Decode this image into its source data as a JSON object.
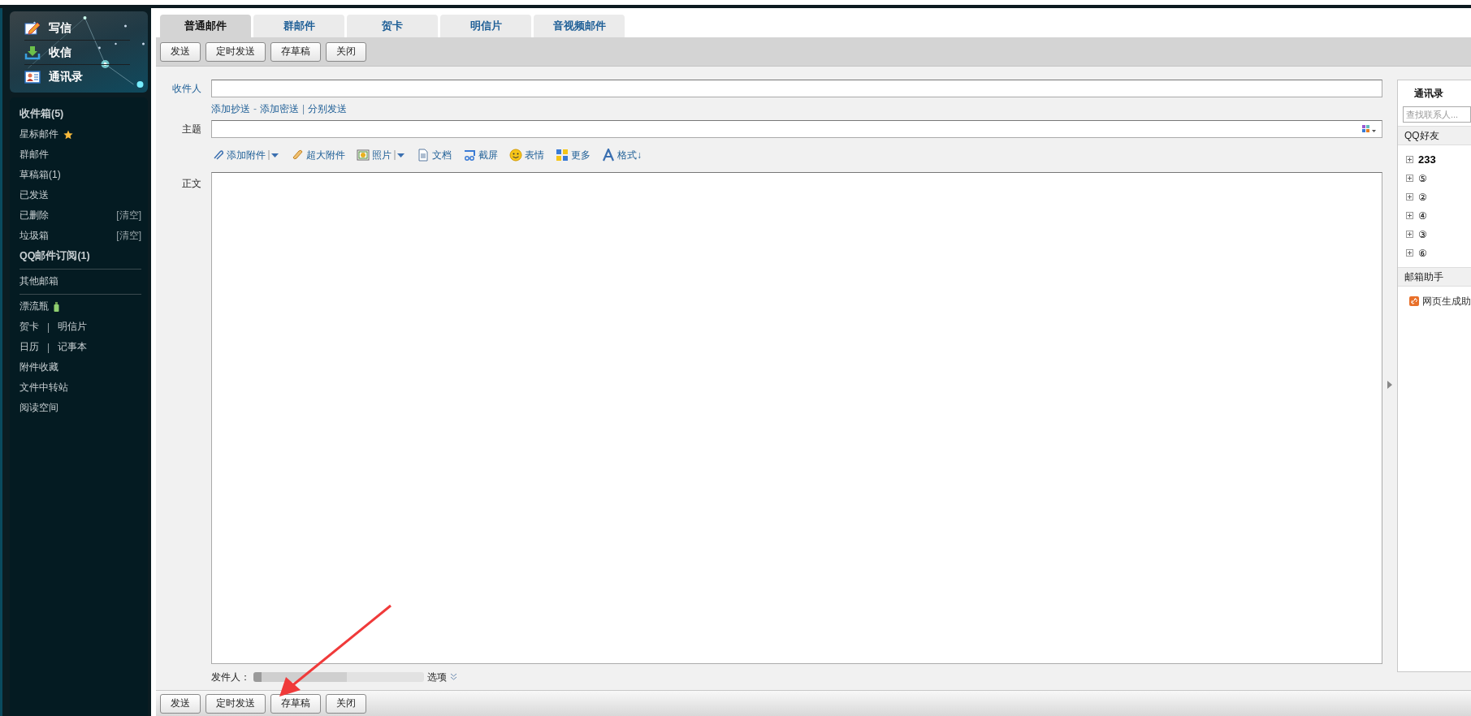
{
  "nav": [
    {
      "label": "写信"
    },
    {
      "label": "收信"
    },
    {
      "label": "通讯录"
    }
  ],
  "folder_groups": [
    [
      {
        "kind": "plain",
        "label": "收件箱(5)",
        "unread": true
      },
      {
        "kind": "star",
        "label": "星标邮件",
        "unread": false
      },
      {
        "kind": "plain",
        "label": "群邮件",
        "unread": false
      },
      {
        "kind": "plain",
        "label": "草稿箱(1)",
        "unread": false
      },
      {
        "kind": "plain",
        "label": "已发送",
        "unread": false
      },
      {
        "kind": "clear",
        "label": "已删除",
        "action": "[清空]",
        "unread": false
      },
      {
        "kind": "clear",
        "label": "垃圾箱",
        "action": "[清空]",
        "unread": false
      },
      {
        "kind": "plain",
        "label": "QQ邮件订阅(1)",
        "unread": true
      }
    ],
    [
      {
        "kind": "plain",
        "label": "其他邮箱",
        "unread": false
      }
    ],
    [
      {
        "kind": "bottle",
        "label": "漂流瓶",
        "unread": false
      },
      {
        "kind": "pair",
        "label": "贺卡",
        "second": "明信片",
        "separator": "|",
        "unread": false
      },
      {
        "kind": "pair",
        "label": "日历",
        "second": "记事本",
        "separator": "|",
        "unread": false
      },
      {
        "kind": "plain",
        "label": "附件收藏",
        "unread": false
      },
      {
        "kind": "plain",
        "label": "文件中转站",
        "unread": false
      },
      {
        "kind": "plain",
        "label": "阅读空间",
        "unread": false
      }
    ]
  ],
  "tabs": [
    {
      "label": "普通邮件",
      "selected": true
    },
    {
      "label": "群邮件",
      "selected": false
    },
    {
      "label": "贺卡",
      "selected": false
    },
    {
      "label": "明信片",
      "selected": false
    },
    {
      "label": "音视频邮件",
      "selected": false
    }
  ],
  "top_buttons": [
    "发送",
    "定时发送",
    "存草稿",
    "关闭"
  ],
  "compose": {
    "to_label": "收件人",
    "recipient_links": [
      {
        "kind": "link",
        "text": "添加抄送"
      },
      {
        "kind": "sep",
        "text": "-"
      },
      {
        "kind": "link",
        "text": "添加密送"
      },
      {
        "kind": "sep",
        "text": "|"
      },
      {
        "kind": "link",
        "text": "分别发送"
      }
    ],
    "subject_label": "主题",
    "attach_tools": [
      {
        "label": "添加附件",
        "dropdown": true
      },
      {
        "label": "超大附件",
        "dropdown": false
      },
      {
        "label": "照片",
        "dropdown": true
      },
      {
        "label": "文档",
        "dropdown": false
      },
      {
        "label": "截屏",
        "dropdown": false
      },
      {
        "label": "表情",
        "dropdown": false
      },
      {
        "label": "更多",
        "dropdown": false
      },
      {
        "label": "格式↓",
        "dropdown": false
      }
    ],
    "body_label": "正文",
    "sender_label": "发件人：",
    "options_label": "选项"
  },
  "bottom_buttons": [
    "发送",
    "定时发送",
    "存草稿",
    "关闭"
  ],
  "contacts": {
    "title": "通讯录",
    "search_placeholder": "查找联系人...",
    "sections": [
      {
        "title": "QQ好友",
        "groups": [
          {
            "label": "233",
            "expanded": false
          },
          {
            "label": "⑤",
            "expanded": false
          },
          {
            "label": "②",
            "expanded": false
          },
          {
            "label": "④",
            "expanded": false
          },
          {
            "label": "③",
            "expanded": false
          },
          {
            "label": "⑥",
            "expanded": false
          }
        ]
      },
      {
        "title": "邮箱助手",
        "items": [
          {
            "label": "网页生成助"
          }
        ]
      }
    ]
  }
}
